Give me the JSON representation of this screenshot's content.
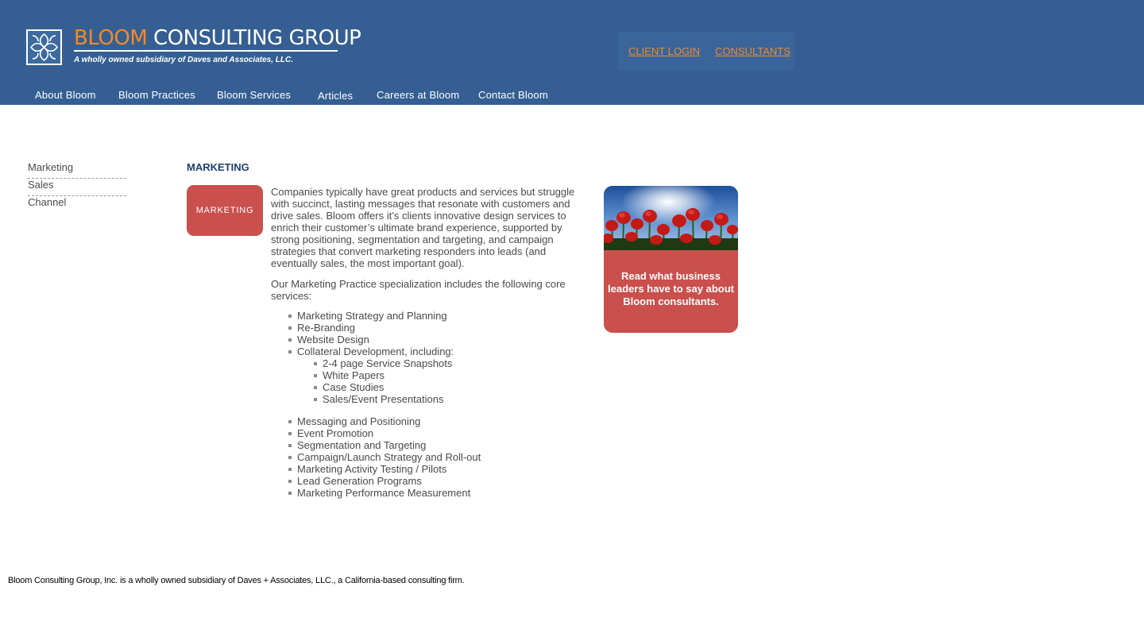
{
  "brand": {
    "name_part1": "BLOOM",
    "name_part2": "CONSULTING GROUP",
    "tagline": "A wholly owned subsidiary of Daves and Associates, LLC.",
    "logo_icon": "floral-logo-icon"
  },
  "top_links": [
    "CLIENT LOGIN",
    "CONSULTANTS"
  ],
  "nav": [
    "About Bloom",
    "Bloom Practices",
    "Bloom Services",
    "Articles",
    "Careers at Bloom",
    "Contact Bloom"
  ],
  "sidebar": [
    "Marketing",
    "Sales",
    "Channel"
  ],
  "main": {
    "heading": "MARKETING",
    "badge": "MARKETING",
    "intro": "Companies typically have great products and services but struggle with succinct, lasting messages that resonate with customers and drive sales. Bloom offers it’s clients innovative design services to enrich their customer’s ultimate brand experience, supported by strong positioning, segmentation and targeting, and campaign strategies that convert marketing responders into leads (and eventually sales, the most important goal).",
    "services_intro": "Our Marketing Practice specialization includes the following core services:",
    "services_a": [
      "Marketing Strategy and Planning",
      "Re-Branding",
      "Website Design",
      "Collateral Development, including:"
    ],
    "collateral": [
      "2-4 page Service Snapshots",
      "White Papers",
      "Case Studies",
      "Sales/Event Presentations"
    ],
    "services_b": [
      "Messaging and Positioning",
      "Event Promotion",
      "Segmentation and Targeting",
      "Campaign/Launch Strategy and Roll-out",
      "Marketing Activity Testing / Pilots",
      "Lead Generation Programs",
      "Marketing Performance Measurement"
    ]
  },
  "promo": {
    "text": "Read what business leaders have to say about Bloom consultants.",
    "image": "red-tulips-photo"
  },
  "footer": "Bloom Consulting Group, Inc. is a wholly owned subsidiary of Daves + Associates, LLC., a California-based consulting firm.",
  "colors": {
    "header": "#355f93",
    "accent": "#f08a2c",
    "badge": "#c9504c",
    "heading": "#1f3f6e"
  }
}
